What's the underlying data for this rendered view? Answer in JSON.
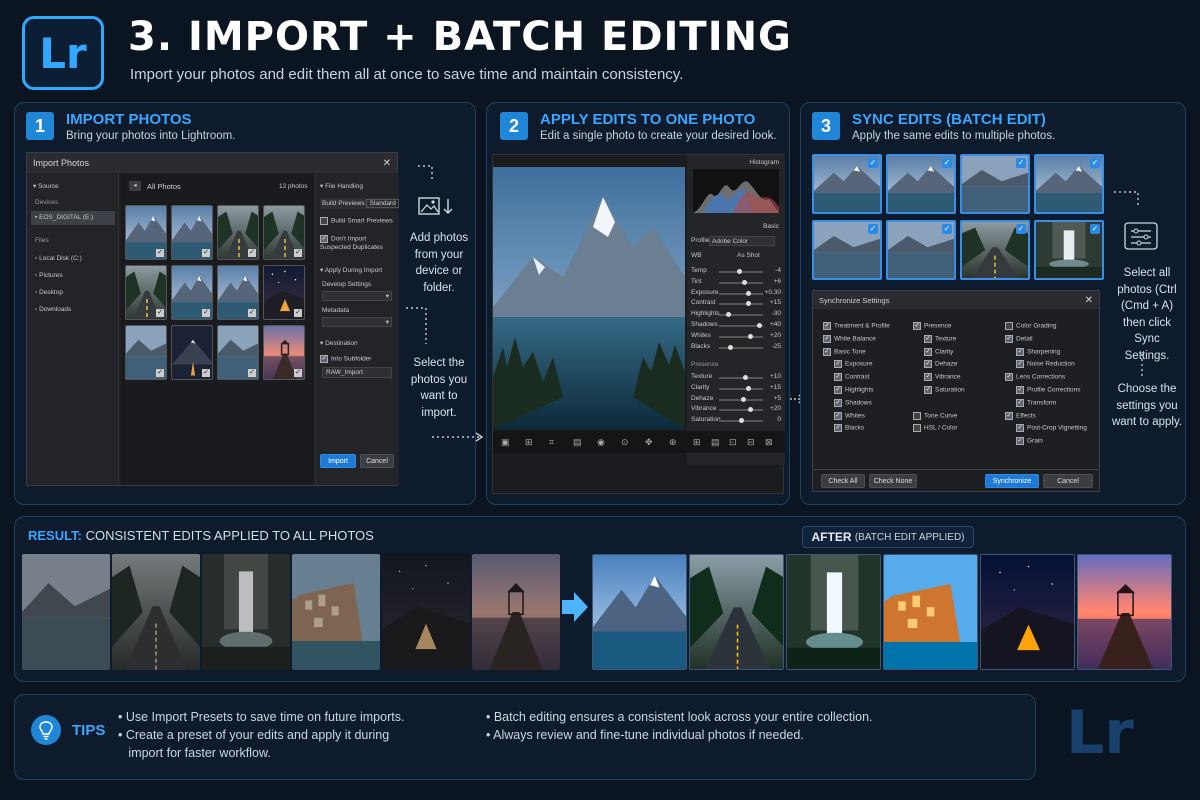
{
  "header": {
    "logo": "Lr",
    "title": "3. IMPORT + BATCH EDITING",
    "subtitle": "Import your photos and edit them all at once to save time and maintain consistency."
  },
  "step1": {
    "number": "1",
    "title": "IMPORT PHOTOS",
    "description": "Bring your photos into Lightroom.",
    "window_title": "Import Photos",
    "source_label": "Source",
    "devices_label": "Devices",
    "device_name": "EOS_DIGITAL (E:)",
    "files_label": "Files",
    "files": [
      "Local Disk (C:)",
      "Pictures",
      "Desktop",
      "Downloads"
    ],
    "all_photos": "All Photos",
    "photo_count": "12 photos",
    "file_handling": {
      "title": "File Handling",
      "build_previews_label": "Build Previews",
      "build_previews_value": "Standard",
      "smart_previews": "Build Smart Previews",
      "dont_import_dupes": "Don't Import Suspected Duplicates",
      "apply_during_import": "Apply During Import",
      "develop_settings": "Develop Settings",
      "metadata": "Metadata",
      "destination": "Destination",
      "into_subfolder": "Into Subfolder",
      "subfolder_value": "RAW_Import"
    },
    "import_button": "Import",
    "cancel_button": "Cancel",
    "annotation_add": "Add photos from your device or folder.",
    "annotation_select": "Select the photos you want to import."
  },
  "step2": {
    "number": "2",
    "title": "APPLY EDITS TO ONE PHOTO",
    "description": "Edit a single photo to create your desired look.",
    "histogram_label": "Histogram",
    "basic_label": "Basic",
    "profile_label": "Profile",
    "profile_value": "Adobe Color",
    "wb_label": "WB",
    "wb_value": "As Shot",
    "sliders_basic": [
      {
        "label": "Temp",
        "value": "-4"
      },
      {
        "label": "Tint",
        "value": "+6"
      },
      {
        "label": "Exposure",
        "value": "+0.30"
      },
      {
        "label": "Contrast",
        "value": "+15"
      },
      {
        "label": "Highlights",
        "value": "-30"
      },
      {
        "label": "Shadows",
        "value": "+40"
      },
      {
        "label": "Whites",
        "value": "+20"
      },
      {
        "label": "Blacks",
        "value": "-25"
      }
    ],
    "presence_label": "Presence",
    "sliders_presence": [
      {
        "label": "Texture",
        "value": "+10"
      },
      {
        "label": "Clarity",
        "value": "+15"
      },
      {
        "label": "Dehaze",
        "value": "+5"
      },
      {
        "label": "Vibrance",
        "value": "+20"
      },
      {
        "label": "Saturation",
        "value": "0"
      }
    ]
  },
  "step3": {
    "number": "3",
    "title": "SYNC EDITS (BATCH EDIT)",
    "description": "Apply the same edits to multiple photos.",
    "dialog_title": "Synchronize Settings",
    "col1": [
      {
        "label": "Treatment & Profile",
        "indent": 0
      },
      {
        "label": "White Balance",
        "indent": 0
      },
      {
        "label": "Basic Tone",
        "indent": 0
      },
      {
        "label": "Exposure",
        "indent": 1
      },
      {
        "label": "Contrast",
        "indent": 1
      },
      {
        "label": "Highlights",
        "indent": 1
      },
      {
        "label": "Shadows",
        "indent": 1
      },
      {
        "label": "Whites",
        "indent": 1
      },
      {
        "label": "Blacks",
        "indent": 1
      }
    ],
    "col2": [
      {
        "label": "Presence",
        "indent": 0,
        "checked": true
      },
      {
        "label": "Texture",
        "indent": 1,
        "checked": true
      },
      {
        "label": "Clarity",
        "indent": 1,
        "checked": true
      },
      {
        "label": "Dehaze",
        "indent": 1,
        "checked": true
      },
      {
        "label": "Vibrance",
        "indent": 1,
        "checked": true
      },
      {
        "label": "Saturation",
        "indent": 1,
        "checked": true
      },
      {
        "label": "",
        "indent": 0,
        "checked": false
      },
      {
        "label": "Tone Curve",
        "indent": 0,
        "checked": false
      },
      {
        "label": "HSL / Color",
        "indent": 0,
        "checked": false
      }
    ],
    "col3": [
      {
        "label": "Color Grading",
        "indent": 0,
        "checked": false
      },
      {
        "label": "Detail",
        "indent": 0,
        "checked": true
      },
      {
        "label": "Sharpening",
        "indent": 1,
        "checked": true
      },
      {
        "label": "Noise Reduction",
        "indent": 1,
        "checked": true
      },
      {
        "label": "Lens Corrections",
        "indent": 0,
        "checked": true
      },
      {
        "label": "Profile Corrections",
        "indent": 1,
        "checked": true
      },
      {
        "label": "Transform",
        "indent": 1,
        "checked": true
      },
      {
        "label": "Effects",
        "indent": 0,
        "checked": true
      },
      {
        "label": "Post-Crop Vignetting",
        "indent": 1,
        "checked": true
      },
      {
        "label": "Grain",
        "indent": 1,
        "checked": true
      }
    ],
    "check_all": "Check All",
    "check_none": "Check None",
    "synchronize": "Synchronize",
    "cancel": "Cancel",
    "annotation_select": "Select all photos (Ctrl (Cmd + A) then click Sync Settings.",
    "annotation_choose": "Choose the settings you want to apply."
  },
  "result": {
    "label_bold": "RESULT:",
    "label_rest": "CONSISTENT EDITS APPLIED TO ALL PHOTOS",
    "after_bold": "AFTER",
    "after_rest": "(BATCH EDIT APPLIED)"
  },
  "tips": {
    "label": "TIPS",
    "items_left": [
      "• Use Import Presets to save time on future imports.",
      "• Create a preset of your edits and apply it during",
      "   import for faster workflow."
    ],
    "items_right": [
      "• Batch editing ensures a consistent look across your entire collection.",
      "• Always review and fine-tune individual photos if needed."
    ]
  },
  "footer_logo": "Lr",
  "colors": {
    "accent": "#31a8ff",
    "background": "#0b1522",
    "panel": "#0d1b2c",
    "button_blue": "#1f7ad6"
  },
  "icons": [
    "lightroom-logo",
    "import-image-icon",
    "sliders-icon",
    "lightbulb-icon",
    "arrow-right-icon",
    "close-icon"
  ]
}
